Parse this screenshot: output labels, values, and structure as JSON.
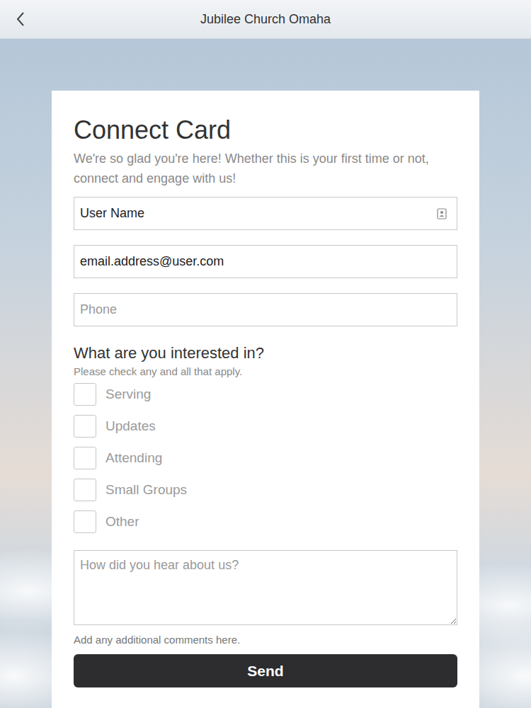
{
  "header": {
    "title": "Jubilee Church Omaha"
  },
  "form": {
    "title": "Connect Card",
    "subtitle": "We're so glad you're here! Whether this is your first time or not, connect and engage with us!",
    "fields": [
      {
        "kind": "filled",
        "text": "User Name"
      },
      {
        "kind": "filled",
        "text": "email.address@user.com"
      },
      {
        "kind": "empty",
        "text": "Phone"
      }
    ],
    "interests_title": "What are you interested in?",
    "interests_hint": "Please check any and all that apply.",
    "interests": [
      {
        "label": "Serving",
        "checked": false
      },
      {
        "label": "Updates",
        "checked": false
      },
      {
        "label": "Attending",
        "checked": false
      },
      {
        "label": "Small Groups",
        "checked": false
      },
      {
        "label": "Other",
        "checked": false
      }
    ],
    "comments_placeholder": "How did you hear about us?",
    "comments_hint": "Add any additional comments here.",
    "submit": "Send"
  }
}
